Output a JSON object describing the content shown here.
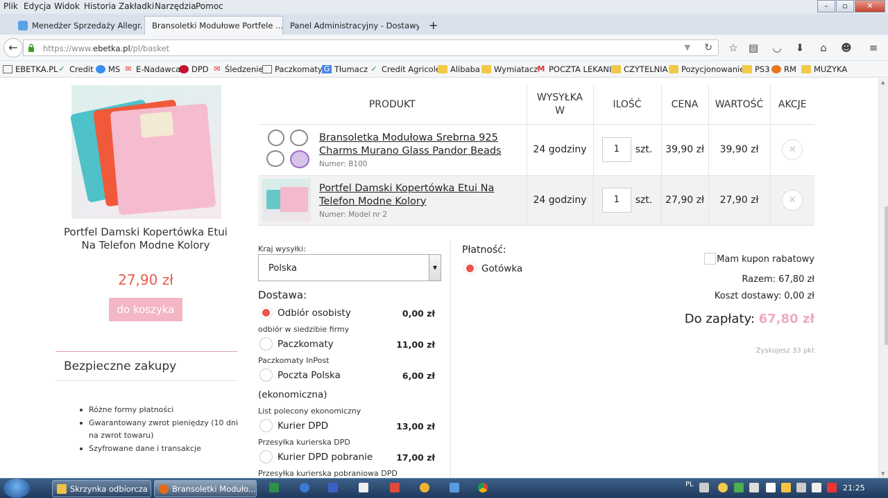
{
  "menu": [
    "Plik",
    "Edycja",
    "Widok",
    "Historia",
    "Zakładki",
    "Narzędzia",
    "Pomoc"
  ],
  "tabs": [
    {
      "label": "Menedżer Sprzedaży Allegr...",
      "active": false,
      "icon": "allegro-icon",
      "color": "#5aa1e8"
    },
    {
      "label": "Bransoletki Modułowe Portfele ...",
      "active": true
    },
    {
      "label": "Panel Administracyjny - Dostawy",
      "active": false
    }
  ],
  "url": {
    "prefix": "https://www.",
    "domain": "ebetka.pl",
    "path": "/pl/basket"
  },
  "bookmarks": [
    {
      "label": "EBETKA.PL",
      "icon": "page-icon"
    },
    {
      "label": "Credit",
      "icon": "bank-icon"
    },
    {
      "label": "MS",
      "icon": "messenger-icon"
    },
    {
      "label": "E-Nadawca",
      "icon": "post-icon"
    },
    {
      "label": "DPD",
      "icon": "dpd-icon"
    },
    {
      "label": "Śledzenie",
      "icon": "post-icon"
    },
    {
      "label": "Paczkomaty",
      "icon": "page-icon"
    },
    {
      "label": "Tłumacz",
      "icon": "translate-icon"
    },
    {
      "label": "Credit Agricole",
      "icon": "bank-icon"
    },
    {
      "label": "Alibaba",
      "icon": "folder-icon"
    },
    {
      "label": "Wymiatacz",
      "icon": "folder-icon"
    },
    {
      "label": "POCZTA LEKANI",
      "icon": "gmail-icon"
    },
    {
      "label": "CZYTELNIA",
      "icon": "folder-icon"
    },
    {
      "label": "Pozycjonowanie",
      "icon": "folder-icon"
    },
    {
      "label": "PS3",
      "icon": "folder-icon"
    },
    {
      "label": "RM",
      "icon": "pumpkin-icon"
    },
    {
      "label": "MUZYKA",
      "icon": "folder-icon"
    }
  ],
  "sidebar": {
    "product_title": "Portfel Damski Kopertówka Etui Na Telefon Modne Kolory",
    "product_price": "27,90 zł",
    "cart_button": "do koszyka",
    "safe_title": "Bezpieczne zakupy",
    "safe_items": [
      "Różne formy płatności",
      "Gwarantowany zwrot pieniędzy (10 dni na zwrot towaru)",
      "Szyfrowane dane i transakcje"
    ]
  },
  "cart": {
    "headers": [
      "PRODUKT",
      "WYSYŁKA W",
      "ILOŚĆ",
      "CENA",
      "WARTOŚĆ",
      "AKCJE"
    ],
    "rows": [
      {
        "name": "Bransoletka Modułowa Srebrna 925 Charms Murano Glass Pandor Beads",
        "number": "Numer: B100",
        "shipping": "24 godziny",
        "qty": "1",
        "unit": "szt.",
        "price": "39,90 zł",
        "value": "39,90 zł"
      },
      {
        "name": "Portfel Damski Kopertówka Etui Na Telefon Modne Kolory",
        "number": "Numer: Model nr 2",
        "shipping": "24 godziny",
        "qty": "1",
        "unit": "szt.",
        "price": "27,90 zł",
        "value": "27,90 zł"
      }
    ]
  },
  "shipping": {
    "country_label": "Kraj wysyłki:",
    "country_value": "Polska",
    "delivery_label": "Dostawa:",
    "options": [
      {
        "name": "Odbiór osobisty",
        "price": "0,00 zł",
        "desc": "odbiór w siedzibie firmy",
        "selected": true
      },
      {
        "name": "Paczkomaty",
        "price": "11,00 zł",
        "desc": "Paczkomaty InPost",
        "selected": false
      },
      {
        "name": "Poczta Polska",
        "name2": "(ekonomiczna)",
        "price": "6,00 zł",
        "desc": "List polecony ekonomiczny",
        "selected": false
      },
      {
        "name": "Kurier DPD",
        "price": "13,00 zł",
        "desc": "Przesyłka kurierska DPD",
        "selected": false
      },
      {
        "name": "Kurier DPD pobranie",
        "price": "17,00 zł",
        "desc": "Przesyłka kurierska pobraniowa DPD",
        "selected": false
      }
    ]
  },
  "payment": {
    "label": "Płatność:",
    "option": "Gotówka"
  },
  "summary": {
    "coupon": "Mam kupon rabatowy",
    "subtotal": "Razem: 67,80 zł",
    "shipping": "Koszt dostawy: 0,00 zł",
    "total_label": "Do zapłaty:",
    "total_value": "67,80 zł",
    "points": "Zyskujesz 33 pkt"
  },
  "taskbar": {
    "windows": [
      "Skrzynka odbiorcza -...",
      "Bransoletki Moduło..."
    ],
    "lang": "PL",
    "clock": "21:25"
  }
}
